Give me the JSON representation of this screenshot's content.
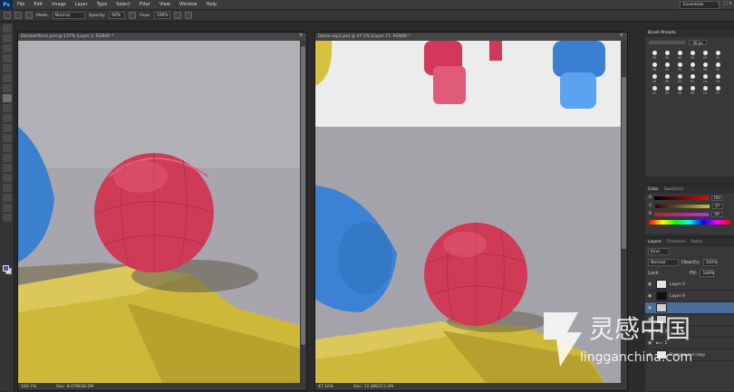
{
  "menubar": {
    "logo": "Ps",
    "items": [
      "File",
      "Edit",
      "Image",
      "Layer",
      "Type",
      "Select",
      "Filter",
      "View",
      "Window",
      "Help"
    ],
    "workspace": "Essentials"
  },
  "options": {
    "mode_label": "Mode:",
    "mode_value": "Normal",
    "opacity_label": "Opacity:",
    "opacity_value": "90%",
    "flow_label": "Flow:",
    "flow_value": "100%"
  },
  "doc_left": {
    "title": "Demoartform.psd @ 137% (Layer 2, RGB/8) *",
    "zoom": "100.7%",
    "doc_size": "Doc: 8.07M/38.2M"
  },
  "doc_right": {
    "title": "Demo-wip1.psd @ 47.1% (Layer 17, RGB/8) *",
    "zoom": "47.16%",
    "doc_size": "Doc: 22.8M/213.2M"
  },
  "brush_presets": {
    "title": "Brush Presets",
    "size": "30 px",
    "sizes": [
      "30",
      "30",
      "30",
      "25",
      "25",
      "25",
      "36",
      "25",
      "36",
      "36",
      "36",
      "32",
      "25",
      "50",
      "25",
      "61",
      "14",
      "24",
      "27",
      "39",
      "46",
      "59",
      "11",
      "17",
      "23",
      "36",
      "44",
      "60",
      "14",
      "26",
      "33",
      "42",
      "55",
      "70",
      "112",
      "134"
    ]
  },
  "color_panel": {
    "tabs": [
      "Color",
      "Swatches"
    ],
    "r_label": "R",
    "r_value": "192",
    "g_label": "G",
    "g_value": "37",
    "b_label": "B",
    "b_value": "49"
  },
  "layers_panel": {
    "tabs": [
      "Layers",
      "Channels",
      "Paths"
    ],
    "kind_label": "Kind",
    "blend_mode": "Normal",
    "opacity_label": "Opacity:",
    "opacity_value": "100%",
    "lock_label": "Lock:",
    "fill_label": "Fill:",
    "fill_value": "100%",
    "layers": [
      {
        "name": "Layer 2"
      },
      {
        "name": "Layer 9"
      },
      {
        "name": ""
      },
      {
        "name": ""
      },
      {
        "name": "2"
      },
      {
        "name": "1"
      },
      {
        "name": "Background copy"
      }
    ]
  },
  "watermark": {
    "cn": "灵感中国",
    "url": "lingganchina.com"
  },
  "colors": {
    "accent_selected": "#4d6d99",
    "foreground_swatch": "#5e4bb5"
  }
}
